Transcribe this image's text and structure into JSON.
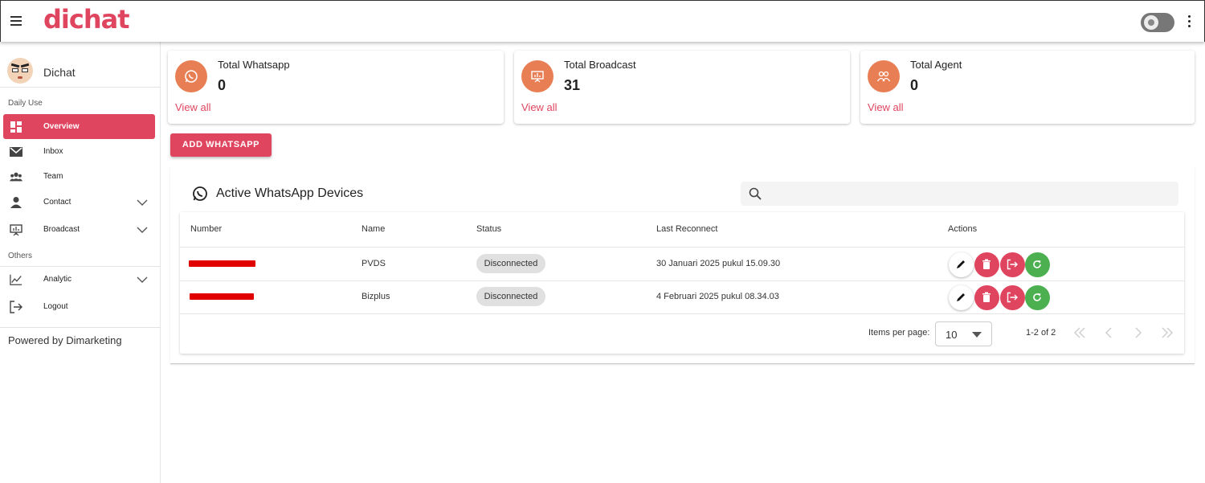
{
  "app": {
    "logo": "dichat"
  },
  "sidebar": {
    "user_name": "Dichat",
    "sections": {
      "daily": "Daily Use",
      "others": "Others"
    },
    "items": [
      {
        "label": "Overview",
        "icon": "dashboard-icon"
      },
      {
        "label": "Inbox",
        "icon": "mail-icon"
      },
      {
        "label": "Team",
        "icon": "group-icon"
      },
      {
        "label": "Contact",
        "icon": "person-icon"
      },
      {
        "label": "Broadcast",
        "icon": "presentation-icon"
      },
      {
        "label": "Analytic",
        "icon": "line-chart-icon"
      },
      {
        "label": "Logout",
        "icon": "logout-icon"
      }
    ],
    "footer": "Powered by Dimarketing"
  },
  "stats": [
    {
      "title": "Total Whatsapp",
      "value": "0",
      "link": "View all",
      "icon": "whatsapp-icon"
    },
    {
      "title": "Total Broadcast",
      "value": "31",
      "link": "View all",
      "icon": "broadcast-icon"
    },
    {
      "title": "Total Agent",
      "value": "0",
      "link": "View all",
      "icon": "agents-icon"
    }
  ],
  "add_button": "ADD WHATSAPP",
  "devices": {
    "title": "Active WhatsApp Devices",
    "search_placeholder": "",
    "columns": [
      "Number",
      "Name",
      "Status",
      "Last Reconnect",
      "Actions"
    ],
    "rows": [
      {
        "name": "PVDS",
        "status": "Disconnected",
        "last_reconnect": "30 Januari 2025 pukul 15.09.30"
      },
      {
        "name": "Bizplus",
        "status": "Disconnected",
        "last_reconnect": "4 Februari 2025 pukul 08.34.03"
      }
    ],
    "pagination": {
      "label": "Items per page:",
      "page_size": "10",
      "range": "1-2 of 2"
    }
  },
  "colors": {
    "accent": "#e0455f",
    "stat_circle": "#e87f54",
    "refresh": "#4caf50",
    "redaction": "#e10000"
  }
}
